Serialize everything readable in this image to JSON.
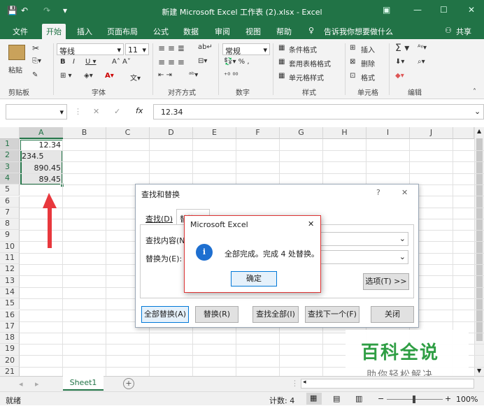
{
  "titlebar": {
    "title": "新建 Microsoft Excel 工作表 (2).xlsx  -  Excel",
    "save_icon": "💾",
    "undo_icon": "↶",
    "redo_icon": "↷",
    "qat_more": "▾",
    "ribbon_display": "▣",
    "minimize": "—",
    "restore": "☐",
    "close": "✕"
  },
  "tabs": [
    "文件",
    "开始",
    "插入",
    "页面布局",
    "公式",
    "数据",
    "审阅",
    "视图",
    "帮助"
  ],
  "tell_me": "告诉我你想要做什么",
  "share": "共享",
  "ribbon": {
    "paste": "粘贴",
    "font_name": "等线",
    "font_size": "11",
    "number_format": "常规",
    "cond_format": "条件格式",
    "table_format": "套用表格格式",
    "cell_style": "单元格样式",
    "insert": "插入",
    "delete": "删除",
    "format": "格式",
    "groups": {
      "clipboard": "剪贴板",
      "font": "字体",
      "alignment": "对齐方式",
      "number": "数字",
      "styles": "样式",
      "cells": "单元格",
      "editing": "编辑"
    }
  },
  "formula_bar": {
    "fx": "fx",
    "value": "12.34",
    "cancel": "✕",
    "enter": "✓"
  },
  "columns": [
    "A",
    "B",
    "C",
    "D",
    "E",
    "F",
    "G",
    "H",
    "I",
    "J"
  ],
  "rows": [
    "1",
    "2",
    "3",
    "4",
    "5",
    "6",
    "7",
    "8",
    "9",
    "10",
    "11",
    "12",
    "13",
    "14",
    "15",
    "16",
    "17",
    "18",
    "19",
    "20",
    "21"
  ],
  "cells": {
    "A1": "12.34",
    "A2": "234.5",
    "A3": "890.45",
    "A4": "89.45"
  },
  "find_dialog": {
    "title": "查找和替换",
    "help": "?",
    "close": "✕",
    "tab_find": "查找(D)",
    "tab_replace": "替换(P)",
    "find_label": "查找内容(N)",
    "replace_label": "替换为(E):",
    "options": "选项(T) >>",
    "replace_all": "全部替换(A)",
    "replace": "替换(R)",
    "find_all": "查找全部(I)",
    "find_next": "查找下一个(F)",
    "close_btn": "关闭"
  },
  "message": {
    "title": "Microsoft Excel",
    "close": "✕",
    "icon": "i",
    "text": "全部完成。完成 4 处替换。",
    "ok": "确定"
  },
  "watermark": {
    "line1": "百科全说",
    "line2": "助你轻松解决"
  },
  "sheet_tab": "Sheet1",
  "add_sheet": "+",
  "status": {
    "ready": "就绪",
    "count": "计数: 4",
    "zoom": "100%",
    "minus": "−",
    "plus": "+"
  },
  "colors": {
    "excel_green": "#217346",
    "arrow_red": "#e8383d",
    "info_blue": "#1e6fd0"
  }
}
